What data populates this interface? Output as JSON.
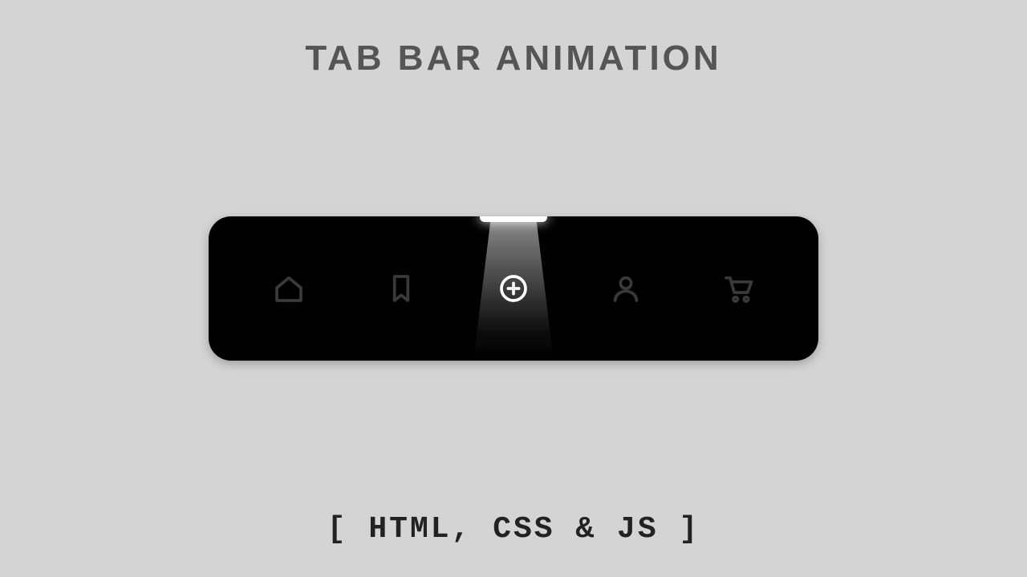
{
  "title": "TAB BAR  ANIMATION",
  "subtitle": "[ HTML, CSS & JS ]",
  "tabbar": {
    "active_index": 2,
    "items": [
      {
        "name": "home",
        "icon": "home-icon"
      },
      {
        "name": "bookmark",
        "icon": "bookmark-icon"
      },
      {
        "name": "add",
        "icon": "plus-circle-icon"
      },
      {
        "name": "profile",
        "icon": "user-icon"
      },
      {
        "name": "cart",
        "icon": "cart-icon"
      }
    ]
  },
  "colors": {
    "page_bg": "#d4d4d4",
    "bar_bg": "#000000",
    "icon_inactive": "#3a3a3a",
    "icon_active": "#ffffff",
    "title": "#555555",
    "subtitle": "#222222"
  }
}
